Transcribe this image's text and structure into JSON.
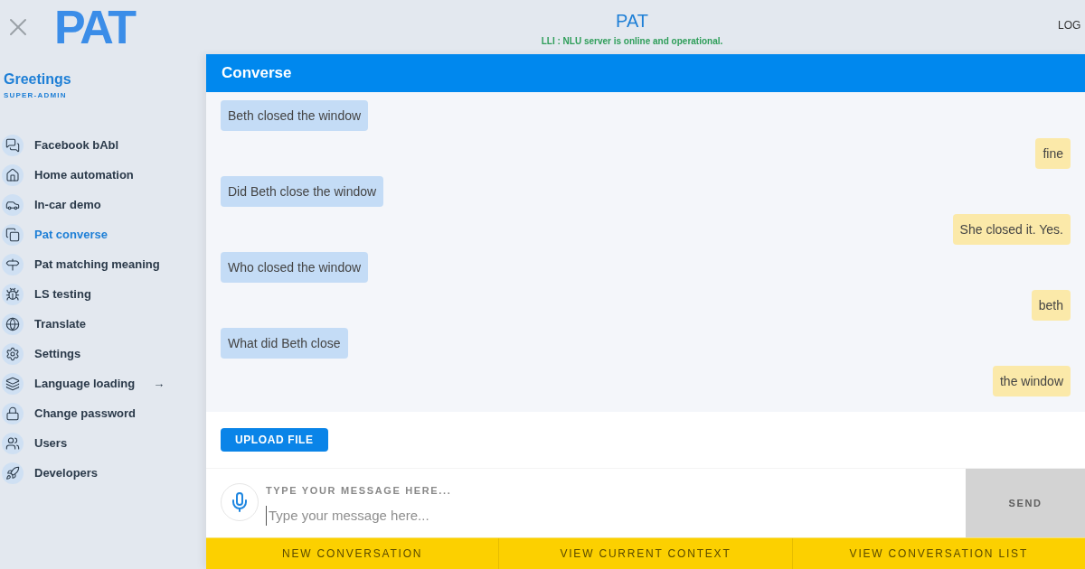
{
  "header": {
    "logo": "PAT",
    "title": "PAT",
    "status": "LLI : NLU server is online and operational.",
    "logout": "LOG"
  },
  "sidebar": {
    "greeting": "Greetings",
    "role": "SUPER-ADMIN",
    "items": [
      {
        "label": "Facebook bAbl",
        "selected": false
      },
      {
        "label": "Home automation",
        "selected": false
      },
      {
        "label": "In-car demo",
        "selected": false
      },
      {
        "label": "Pat converse",
        "selected": true
      },
      {
        "label": "Pat matching meaning",
        "selected": false
      },
      {
        "label": "LS testing",
        "selected": false
      },
      {
        "label": "Translate",
        "selected": false
      },
      {
        "label": "Settings",
        "selected": false
      },
      {
        "label": "Language loading",
        "selected": false,
        "arrow": "→"
      },
      {
        "label": "Change password",
        "selected": false
      },
      {
        "label": "Users",
        "selected": false
      },
      {
        "label": "Developers",
        "selected": false
      }
    ]
  },
  "panel": {
    "title": "Converse",
    "messages": [
      {
        "kind": "bot",
        "text": "Beth closed the window"
      },
      {
        "kind": "user",
        "text": "fine"
      },
      {
        "kind": "bot",
        "text": "Did Beth close the window"
      },
      {
        "kind": "user",
        "text": "She closed it. Yes."
      },
      {
        "kind": "bot",
        "text": "Who closed the window"
      },
      {
        "kind": "user",
        "text": "beth"
      },
      {
        "kind": "bot",
        "text": "What did Beth close"
      },
      {
        "kind": "user",
        "text": "the window"
      }
    ],
    "upload": "UPLOAD FILE",
    "input_label": "TYPE YOUR MESSAGE HERE...",
    "placeholder": "Type your message here...",
    "send": "SEND"
  },
  "actions": [
    "NEW CONVERSATION",
    "VIEW CURRENT CONTEXT",
    "VIEW CONVERSATION LIST"
  ]
}
